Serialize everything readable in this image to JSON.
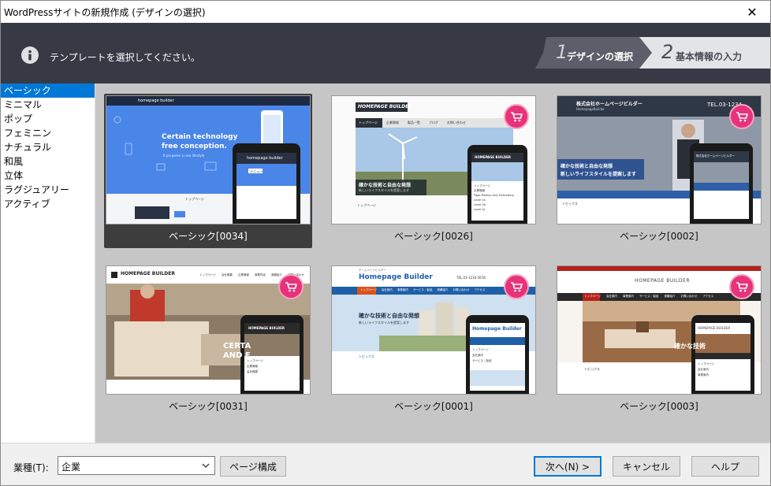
{
  "window": {
    "title": "WordPressサイトの新規作成 (デザインの選択)",
    "close_glyph": "✕"
  },
  "banner": {
    "message": "テンプレートを選択してください。",
    "steps": [
      {
        "number": "1",
        "label": "デザインの選択",
        "active": true
      },
      {
        "number": "2",
        "label": "基本情報の入力",
        "active": false
      }
    ]
  },
  "categories": [
    {
      "label": "ベーシック",
      "selected": true
    },
    {
      "label": "ミニマル"
    },
    {
      "label": "ポップ"
    },
    {
      "label": "フェミニン"
    },
    {
      "label": "ナチュラル"
    },
    {
      "label": "和風"
    },
    {
      "label": "立体"
    },
    {
      "label": "ラグジュアリー"
    },
    {
      "label": "アクティブ"
    }
  ],
  "templates": [
    {
      "label": "ベーシック[0034]",
      "selected": true,
      "paid": false,
      "preview": {
        "brand": "homepage builder",
        "headline1": "Certain technology",
        "headline2": "free conception.",
        "sub": "It proposes a new lifestyle",
        "phone_brand": "homepage builder",
        "nav_item": "メニュー",
        "section": "トップページ"
      }
    },
    {
      "label": "ベーシック[0026]",
      "selected": false,
      "paid": true,
      "preview": {
        "logo": "HOMEPAGE BUILDER",
        "nav": [
          "トップページ",
          "企業情報",
          "製品一覧",
          "ブログ",
          "お問い合わせ"
        ],
        "headline": "確かな技術と自由な発想",
        "sub": "新しいライフスタイルを提案します",
        "section": "トップページ",
        "phone_logo": "HOMEPAGE BUILDER",
        "phone_items": [
          "トップページ",
          "企業情報",
          "Page Markup And Formatting",
          "Level 0a",
          "Level 0b",
          "Level 0c"
        ]
      }
    },
    {
      "label": "ベーシック[0002]",
      "selected": false,
      "paid": true,
      "preview": {
        "company": "株式会社ホームページビルダー",
        "company_sub": "HomepageBuilder",
        "tel": "TEL.03-1234",
        "headline": "確かな技術と自由な発想",
        "sub": "新しいライフスタイルを提案します",
        "section": "トピックス",
        "phone_company": "株式会社ホームページビルダー"
      }
    },
    {
      "label": "ベーシック[0031]",
      "selected": false,
      "paid": true,
      "preview": {
        "logo": "HOMEPAGE BUILDER",
        "nav": [
          "トップページ",
          "会社概要",
          "企業情報",
          "事業内容",
          "実績紹介",
          "お問い合わせ"
        ],
        "hero1": "CERTA",
        "hero2": "AND F",
        "phone_logo": "HOMEPAGE BUILDER",
        "phone_items": [
          "トップページ",
          "企業情報",
          "会社概要"
        ]
      }
    },
    {
      "label": "ベーシック[0001]",
      "selected": false,
      "paid": true,
      "preview": {
        "kana": "ホームページビルダー",
        "logo": "Homepage Builder",
        "tel": "TEL.03-1234-5678",
        "nav": [
          "トップページ",
          "会社案内",
          "事業案内",
          "サービス・製品",
          "実績紹介",
          "お問い合わせ",
          "アクセス"
        ],
        "headline": "確かな技術と自由な発想",
        "sub": "新しいライフスタイルを提案します",
        "section": "トピックス",
        "phone_logo": "Homepage Builder",
        "phone_items": [
          "トップページ",
          "会社案内",
          "サービス・製品"
        ]
      }
    },
    {
      "label": "ベーシック[0003]",
      "selected": false,
      "paid": true,
      "preview": {
        "logo": "HOMEPAGE BUILDER",
        "nav": [
          "トップページ",
          "会社案内",
          "事業案内",
          "サービス・製品",
          "実績紹介",
          "お問い合わせ",
          "アクセス"
        ],
        "headline": "確かな技術",
        "section": "トピックス",
        "phone_logo": "HOMEPAGE BUILDER",
        "phone_items": [
          "トップページ",
          "会社案内",
          "事業案内"
        ]
      }
    }
  ],
  "footer": {
    "industry_label": "業種(T):",
    "industry_value": "企業",
    "page_structure_button": "ページ構成",
    "next_button": "次へ(N) >",
    "cancel_button": "キャンセル",
    "help_button": "ヘルプ"
  },
  "colors": {
    "banner": "#373a45",
    "selection": "#0078d7",
    "cart_badge": "#e6337a",
    "content_bg": "#c6c6c6"
  }
}
